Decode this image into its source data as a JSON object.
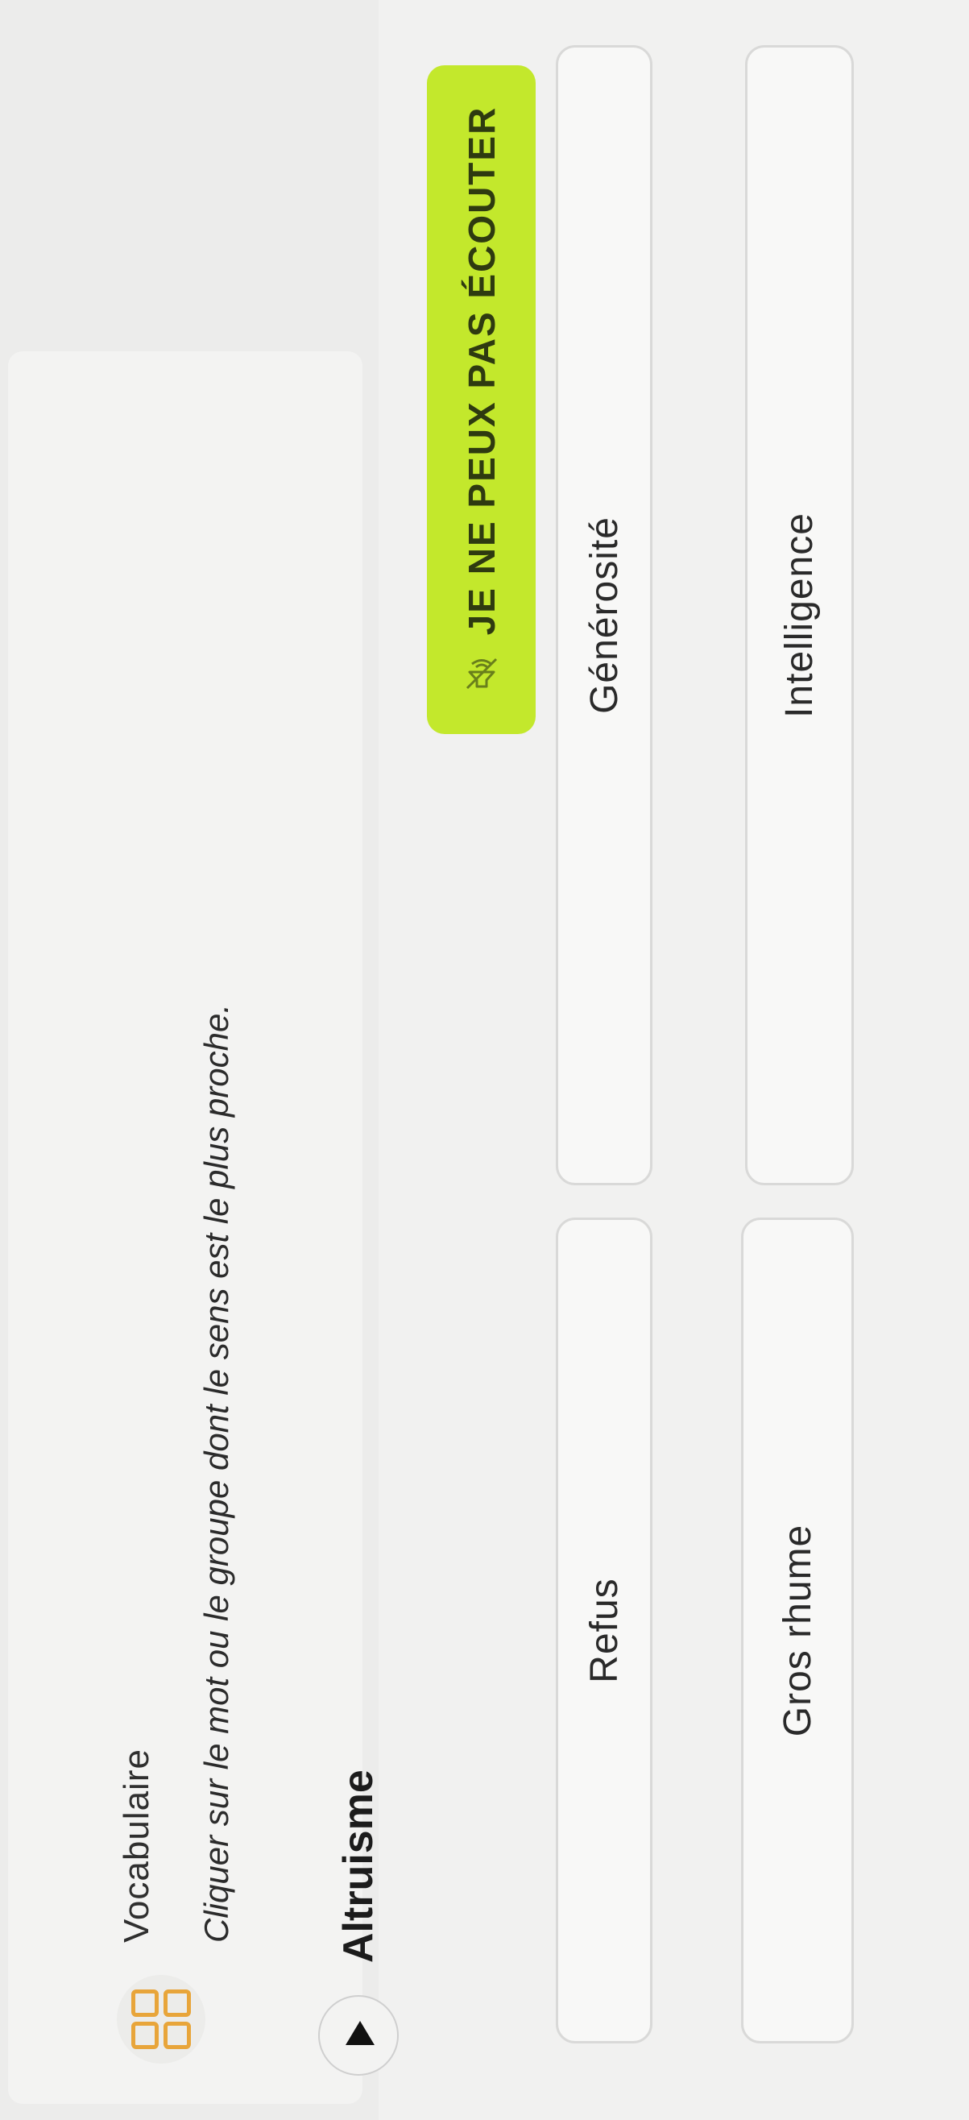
{
  "header": {
    "app_title": "Vocabulaire",
    "instruction": "Cliquer sur le mot ou le groupe dont le sens est le plus proche."
  },
  "exercise": {
    "target_word": "Altruisme",
    "cant_listen_label": "JE NE PEUX PAS ÉCOUTER",
    "options": [
      {
        "label": "Refus"
      },
      {
        "label": "Générosité"
      },
      {
        "label": "Gros rhume"
      },
      {
        "label": "Intelligence"
      }
    ]
  },
  "colors": {
    "accent_button": "#c3e82c",
    "icon_orange": "#e8a53a"
  },
  "icons": {
    "app_icon": "grid-squares-icon",
    "play_icon": "play-triangle-icon",
    "audio_icon": "speaker-muted-icon"
  }
}
